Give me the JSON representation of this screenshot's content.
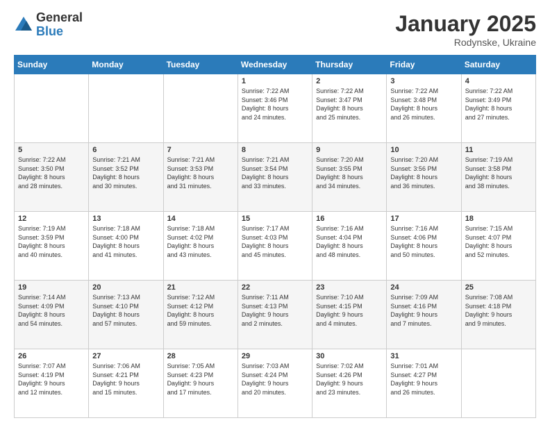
{
  "logo": {
    "general": "General",
    "blue": "Blue"
  },
  "header": {
    "month": "January 2025",
    "location": "Rodynske, Ukraine"
  },
  "weekdays": [
    "Sunday",
    "Monday",
    "Tuesday",
    "Wednesday",
    "Thursday",
    "Friday",
    "Saturday"
  ],
  "weeks": [
    [
      {
        "day": "",
        "info": ""
      },
      {
        "day": "",
        "info": ""
      },
      {
        "day": "",
        "info": ""
      },
      {
        "day": "1",
        "info": "Sunrise: 7:22 AM\nSunset: 3:46 PM\nDaylight: 8 hours\nand 24 minutes."
      },
      {
        "day": "2",
        "info": "Sunrise: 7:22 AM\nSunset: 3:47 PM\nDaylight: 8 hours\nand 25 minutes."
      },
      {
        "day": "3",
        "info": "Sunrise: 7:22 AM\nSunset: 3:48 PM\nDaylight: 8 hours\nand 26 minutes."
      },
      {
        "day": "4",
        "info": "Sunrise: 7:22 AM\nSunset: 3:49 PM\nDaylight: 8 hours\nand 27 minutes."
      }
    ],
    [
      {
        "day": "5",
        "info": "Sunrise: 7:22 AM\nSunset: 3:50 PM\nDaylight: 8 hours\nand 28 minutes."
      },
      {
        "day": "6",
        "info": "Sunrise: 7:21 AM\nSunset: 3:52 PM\nDaylight: 8 hours\nand 30 minutes."
      },
      {
        "day": "7",
        "info": "Sunrise: 7:21 AM\nSunset: 3:53 PM\nDaylight: 8 hours\nand 31 minutes."
      },
      {
        "day": "8",
        "info": "Sunrise: 7:21 AM\nSunset: 3:54 PM\nDaylight: 8 hours\nand 33 minutes."
      },
      {
        "day": "9",
        "info": "Sunrise: 7:20 AM\nSunset: 3:55 PM\nDaylight: 8 hours\nand 34 minutes."
      },
      {
        "day": "10",
        "info": "Sunrise: 7:20 AM\nSunset: 3:56 PM\nDaylight: 8 hours\nand 36 minutes."
      },
      {
        "day": "11",
        "info": "Sunrise: 7:19 AM\nSunset: 3:58 PM\nDaylight: 8 hours\nand 38 minutes."
      }
    ],
    [
      {
        "day": "12",
        "info": "Sunrise: 7:19 AM\nSunset: 3:59 PM\nDaylight: 8 hours\nand 40 minutes."
      },
      {
        "day": "13",
        "info": "Sunrise: 7:18 AM\nSunset: 4:00 PM\nDaylight: 8 hours\nand 41 minutes."
      },
      {
        "day": "14",
        "info": "Sunrise: 7:18 AM\nSunset: 4:02 PM\nDaylight: 8 hours\nand 43 minutes."
      },
      {
        "day": "15",
        "info": "Sunrise: 7:17 AM\nSunset: 4:03 PM\nDaylight: 8 hours\nand 45 minutes."
      },
      {
        "day": "16",
        "info": "Sunrise: 7:16 AM\nSunset: 4:04 PM\nDaylight: 8 hours\nand 48 minutes."
      },
      {
        "day": "17",
        "info": "Sunrise: 7:16 AM\nSunset: 4:06 PM\nDaylight: 8 hours\nand 50 minutes."
      },
      {
        "day": "18",
        "info": "Sunrise: 7:15 AM\nSunset: 4:07 PM\nDaylight: 8 hours\nand 52 minutes."
      }
    ],
    [
      {
        "day": "19",
        "info": "Sunrise: 7:14 AM\nSunset: 4:09 PM\nDaylight: 8 hours\nand 54 minutes."
      },
      {
        "day": "20",
        "info": "Sunrise: 7:13 AM\nSunset: 4:10 PM\nDaylight: 8 hours\nand 57 minutes."
      },
      {
        "day": "21",
        "info": "Sunrise: 7:12 AM\nSunset: 4:12 PM\nDaylight: 8 hours\nand 59 minutes."
      },
      {
        "day": "22",
        "info": "Sunrise: 7:11 AM\nSunset: 4:13 PM\nDaylight: 9 hours\nand 2 minutes."
      },
      {
        "day": "23",
        "info": "Sunrise: 7:10 AM\nSunset: 4:15 PM\nDaylight: 9 hours\nand 4 minutes."
      },
      {
        "day": "24",
        "info": "Sunrise: 7:09 AM\nSunset: 4:16 PM\nDaylight: 9 hours\nand 7 minutes."
      },
      {
        "day": "25",
        "info": "Sunrise: 7:08 AM\nSunset: 4:18 PM\nDaylight: 9 hours\nand 9 minutes."
      }
    ],
    [
      {
        "day": "26",
        "info": "Sunrise: 7:07 AM\nSunset: 4:19 PM\nDaylight: 9 hours\nand 12 minutes."
      },
      {
        "day": "27",
        "info": "Sunrise: 7:06 AM\nSunset: 4:21 PM\nDaylight: 9 hours\nand 15 minutes."
      },
      {
        "day": "28",
        "info": "Sunrise: 7:05 AM\nSunset: 4:23 PM\nDaylight: 9 hours\nand 17 minutes."
      },
      {
        "day": "29",
        "info": "Sunrise: 7:03 AM\nSunset: 4:24 PM\nDaylight: 9 hours\nand 20 minutes."
      },
      {
        "day": "30",
        "info": "Sunrise: 7:02 AM\nSunset: 4:26 PM\nDaylight: 9 hours\nand 23 minutes."
      },
      {
        "day": "31",
        "info": "Sunrise: 7:01 AM\nSunset: 4:27 PM\nDaylight: 9 hours\nand 26 minutes."
      },
      {
        "day": "",
        "info": ""
      }
    ]
  ]
}
